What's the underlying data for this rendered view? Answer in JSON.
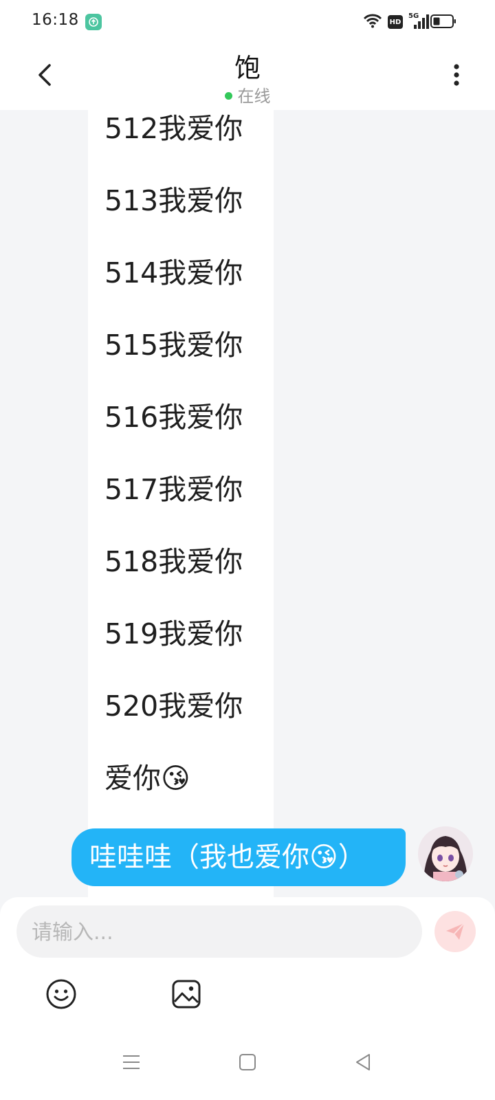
{
  "status_bar": {
    "time": "16:18",
    "hd_label": "HD",
    "network": "5G"
  },
  "header": {
    "title": "饱",
    "status": "在线"
  },
  "messages": {
    "incoming_lines": [
      "512我爱你",
      "513我爱你",
      "514我爱你",
      "515我爱你",
      "516我爱你",
      "517我爱你",
      "518我爱你",
      "519我爱你",
      "520我爱你",
      "爱你😘"
    ],
    "outgoing": "哇哇哇（我也爱你😘）"
  },
  "input": {
    "placeholder": "请输入..."
  },
  "icons": {
    "back": "chevron-left-icon",
    "more": "more-vertical-icon",
    "send": "send-icon",
    "emoji": "emoji-icon",
    "image": "image-icon",
    "nav_menu": "menu-icon",
    "nav_home": "home-square-icon",
    "nav_back": "triangle-back-icon"
  },
  "colors": {
    "accent_blue": "#23b4f7",
    "online_green": "#33c85a",
    "send_bg": "#fde1e1",
    "send_icon": "#f7b6b6"
  }
}
